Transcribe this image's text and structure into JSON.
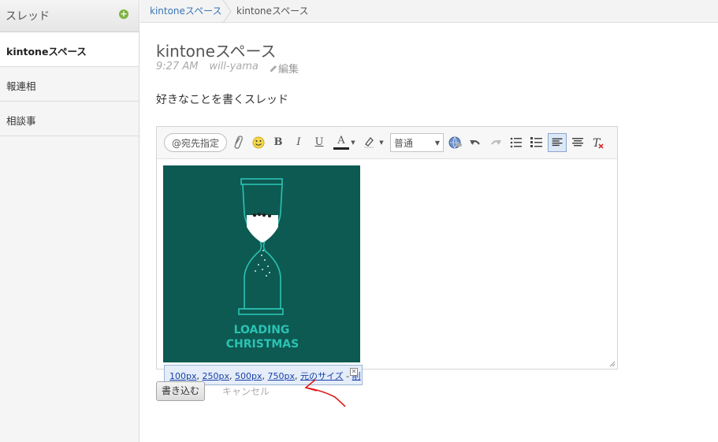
{
  "sidebar": {
    "title": "スレッド",
    "add_icon": "plus-circle-icon",
    "items": [
      {
        "label": "kintoneスペース",
        "active": true
      },
      {
        "label": "報連相",
        "active": false
      },
      {
        "label": "相談事",
        "active": false
      }
    ]
  },
  "breadcrumb": {
    "items": [
      "kintoneスペース",
      "kintoneスペース"
    ]
  },
  "thread": {
    "title": "kintoneスペース",
    "time": "9:27 AM",
    "author": "will-yama",
    "edit_label": "編集",
    "body": "好きなことを書くスレッド"
  },
  "toolbar": {
    "mention_label": "@宛先指定",
    "bold": "B",
    "italic": "I",
    "underline": "U",
    "font_color": "A",
    "format_select_value": "普通",
    "icons": [
      "paperclip-icon",
      "emoji-icon",
      "bold-icon",
      "italic-icon",
      "underline-icon",
      "font-color-icon",
      "highlight-icon",
      "link-icon",
      "undo-icon",
      "redo-icon",
      "bullet-list-icon",
      "numbered-list-icon",
      "align-left-icon",
      "align-center-icon",
      "clear-format-icon"
    ]
  },
  "image": {
    "text_line1": "LOADING",
    "text_line2": "CHRISTMAS",
    "bg_color": "#0d5a52",
    "accent_color": "#2bc2b4"
  },
  "size_popup": {
    "sizes": [
      "100px",
      "250px",
      "500px",
      "750px"
    ],
    "original": "元のサイズ",
    "delete": "削除",
    "comma": ",",
    "dash": "-"
  },
  "actions": {
    "submit": "書き込む",
    "cancel": "キャンセル"
  }
}
